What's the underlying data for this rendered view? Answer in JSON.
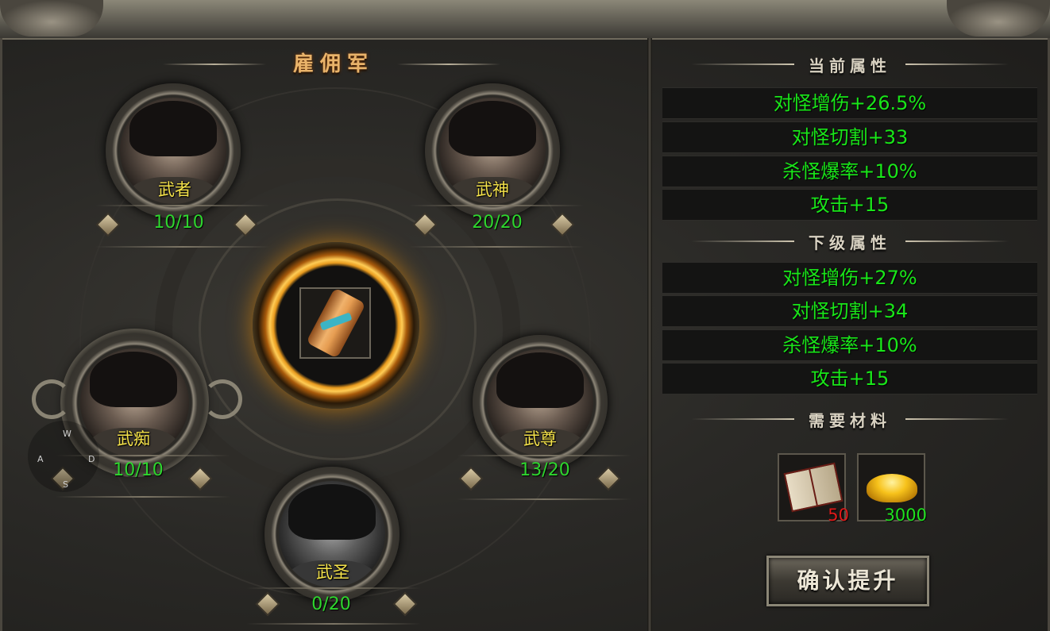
{
  "panel": {
    "title": "雇佣军",
    "wasd": [
      "W",
      "A",
      "S",
      "D"
    ]
  },
  "heroes": [
    {
      "name": "武者",
      "count": "10/10"
    },
    {
      "name": "武神",
      "count": "20/20"
    },
    {
      "name": "武痴",
      "count": "10/10"
    },
    {
      "name": "武尊",
      "count": "13/20"
    },
    {
      "name": "武圣",
      "count": "0/20"
    }
  ],
  "center_item": {
    "icon": "scroll-icon"
  },
  "current_attrs": {
    "header": "当前属性",
    "items": [
      "对怪增伤+26.5%",
      "对怪切割+33",
      "杀怪爆率+10%",
      "攻击+15"
    ]
  },
  "next_attrs": {
    "header": "下级属性",
    "items": [
      "对怪增伤+27%",
      "对怪切割+34",
      "杀怪爆率+10%",
      "攻击+15"
    ]
  },
  "materials": {
    "header": "需要材料",
    "items": [
      {
        "icon": "book-icon",
        "count": "50",
        "count_color": "#e01a1a"
      },
      {
        "icon": "gold-ingot-icon",
        "count": "3000",
        "count_color": "#1fe01f"
      }
    ]
  },
  "confirm_button": "确认提升",
  "colors": {
    "stat_text": "#19e619",
    "hero_name": "#f4e24a",
    "count_text": "#2ed62e"
  }
}
